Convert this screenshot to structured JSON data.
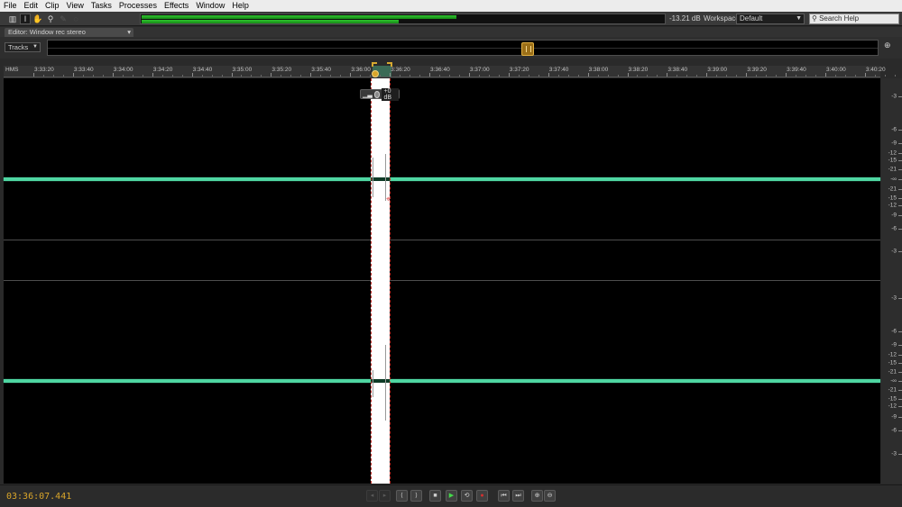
{
  "menu": [
    "File",
    "Edit",
    "Clip",
    "View",
    "Tasks",
    "Processes",
    "Effects",
    "Window",
    "Help"
  ],
  "toolbar": {
    "tools": [
      {
        "name": "waveform-view-icon",
        "glyph": "▥"
      },
      {
        "name": "time-selection-icon",
        "glyph": "I"
      },
      {
        "name": "hand-icon",
        "glyph": "✋"
      },
      {
        "name": "zoom-icon",
        "glyph": "⚲"
      },
      {
        "name": "spot-healing-icon",
        "glyph": "✎"
      },
      {
        "name": "lasso-icon",
        "glyph": "◌"
      }
    ],
    "meter_level_db": "-13.21 dB",
    "meter_levels": [
      0.6,
      0.49
    ],
    "workspace_label": "Workspace:",
    "workspace_value": "Default",
    "search_placeholder": "Search Help"
  },
  "panel": {
    "tab_title": "Editor: Window rec stereo",
    "tracks_button": "Tracks"
  },
  "ruler": {
    "format_label": "HMS",
    "ticks": [
      "3:33:20",
      "3:33:40",
      "3:34:00",
      "3:34:20",
      "3:34:40",
      "3:35:00",
      "3:35:20",
      "3:35:40",
      "3:36:00",
      "3:36:20",
      "3:36:40",
      "3:37:00",
      "3:37:20",
      "3:37:40",
      "3:38:00",
      "3:38:20",
      "3:38:40",
      "3:39:00",
      "3:39:20",
      "3:39:40",
      "3:40:00",
      "3:40:20"
    ]
  },
  "hud": {
    "value": "+0 dB"
  },
  "db_scale": {
    "channel1": [
      "-3",
      "-6",
      "-9",
      "-12",
      "-15",
      "-21",
      "-∞",
      "-21",
      "-15",
      "-12",
      "-9",
      "-6",
      "-3"
    ],
    "channel2": [
      "-3",
      "-6",
      "-9",
      "-12",
      "-15",
      "-21",
      "-∞",
      "-21",
      "-15",
      "-12",
      "-9",
      "-6",
      "-3"
    ]
  },
  "colors": {
    "waveform": "#4fd6a2",
    "timecode": "#d9a52a",
    "selection": "#ffffff"
  },
  "transport": {
    "timecode": "03:36:07.441",
    "buttons": [
      {
        "name": "move-playhead-previous-button",
        "glyph": "◂",
        "dim": true
      },
      {
        "name": "move-playhead-next-button",
        "glyph": "▸",
        "dim": true
      },
      {
        "name": "rewind-button",
        "glyph": "⟨",
        "dim": false
      },
      {
        "name": "fast-forward-button",
        "glyph": "⟩",
        "dim": false
      },
      {
        "name": "stop-button",
        "glyph": "■",
        "dim": false
      },
      {
        "name": "play-button",
        "glyph": "▶",
        "dim": false
      },
      {
        "name": "loop-button",
        "glyph": "⟲",
        "dim": false
      },
      {
        "name": "record-button",
        "glyph": "●",
        "dim": false
      },
      {
        "name": "go-to-start-button",
        "glyph": "⏮",
        "dim": false
      },
      {
        "name": "go-to-end-button",
        "glyph": "⏭",
        "dim": false
      },
      {
        "name": "zoom-in-amplitude-button",
        "glyph": "⊕",
        "dim": false
      },
      {
        "name": "zoom-out-amplitude-button",
        "glyph": "⊖",
        "dim": false
      }
    ]
  }
}
